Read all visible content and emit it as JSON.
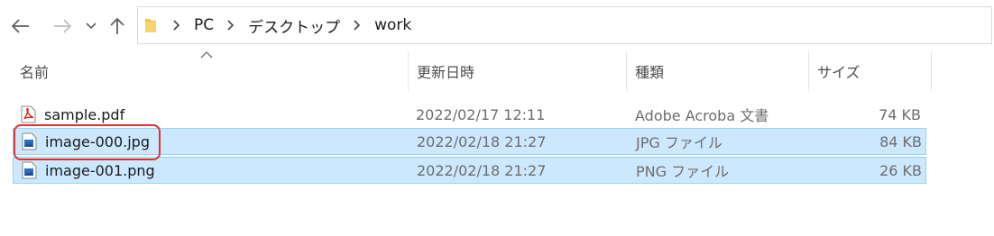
{
  "nav": {
    "back_icon": "back-arrow-icon",
    "forward_icon": "forward-arrow-icon",
    "recent_icon": "chevron-down-icon",
    "up_icon": "up-arrow-icon"
  },
  "address": {
    "folder_icon": "folder-icon",
    "crumbs": [
      "PC",
      "デスクトップ",
      "work"
    ]
  },
  "columns": {
    "name": "名前",
    "modified": "更新日時",
    "type": "種類",
    "size": "サイズ"
  },
  "files": [
    {
      "name": "sample.pdf",
      "modified": "2022/02/17 12:11",
      "type": "Adobe Acroba 文書",
      "size": "74 KB",
      "icon": "pdf-file-icon",
      "selected": false
    },
    {
      "name": "image-000.jpg",
      "modified": "2022/02/18 21:27",
      "type": "JPG ファイル",
      "size": "84 KB",
      "icon": "image-file-icon",
      "selected": true
    },
    {
      "name": "image-001.png",
      "modified": "2022/02/18 21:27",
      "type": "PNG ファイル",
      "size": "26 KB",
      "icon": "image-file-icon",
      "selected": true
    }
  ],
  "colors": {
    "selection_bg": "#cce8ff",
    "selection_border": "#99d1ff",
    "highlight": "#e0322d",
    "folder": "#f2c33c",
    "pdf": "#d9211d"
  }
}
